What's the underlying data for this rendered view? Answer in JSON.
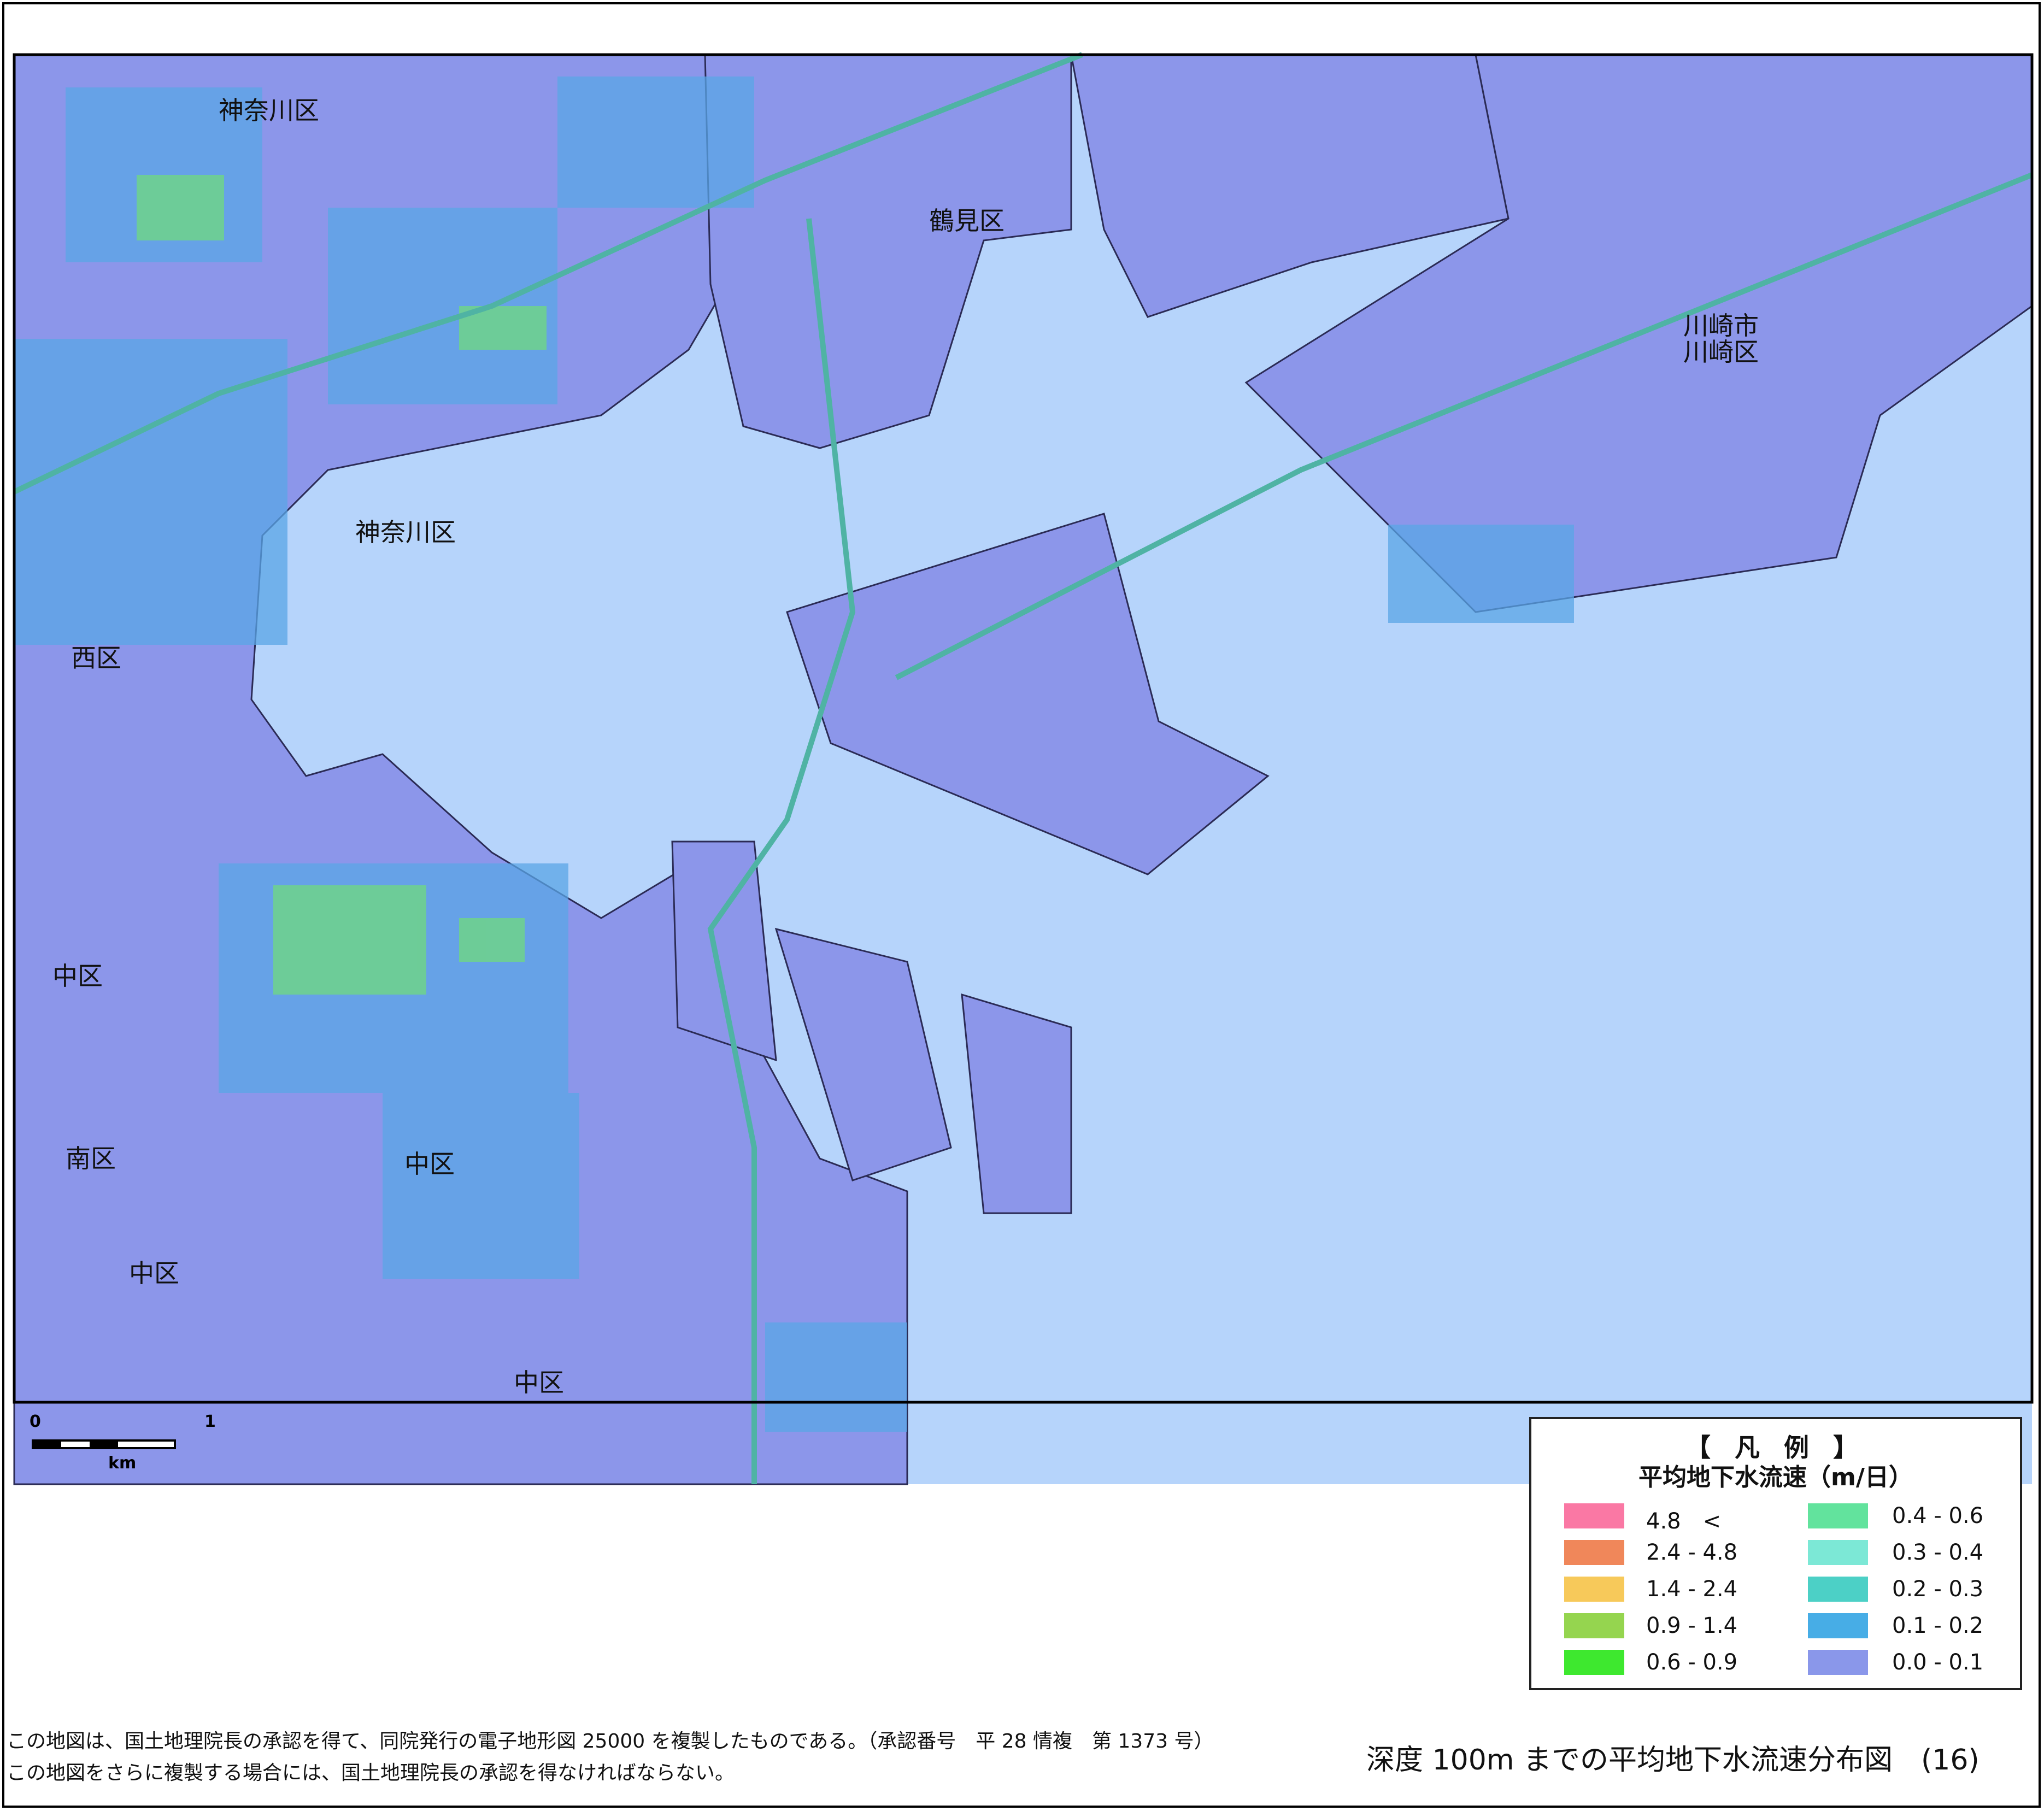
{
  "map": {
    "colors": {
      "land": "#8c96ea",
      "water": "#b6d4fb",
      "velocity_mid": "#5aa6e6",
      "velocity_high": "#6fd48a",
      "road_expressway": "#4fb3a4",
      "boundary": "#222222"
    },
    "labels": {
      "kanagawa_north": "神奈川区",
      "kanagawa_port": "神奈川区",
      "tsurumi": "鶴見区",
      "kawasaki_city": "川崎市",
      "kawasaki_ward": "川崎区",
      "nishi": "西区",
      "naka_1": "中区",
      "naka_2": "中区",
      "naka_3": "中区",
      "naka_4": "中区",
      "minami": "南区"
    },
    "scale": {
      "zero": "0",
      "one": "1",
      "unit": "km"
    }
  },
  "legend": {
    "title": "【 凡 例 】",
    "subtitle": "平均地下水流速（m/日）",
    "items": [
      {
        "label": "4.8　<",
        "color": "#fa78a4"
      },
      {
        "label": "2.4 - 4.8",
        "color": "#f0875a"
      },
      {
        "label": "1.4 - 2.4",
        "color": "#f7c95a"
      },
      {
        "label": "0.9 - 1.4",
        "color": "#95d54f"
      },
      {
        "label": "0.6 - 0.9",
        "color": "#3ee82f"
      },
      {
        "label": "0.4 - 0.6",
        "color": "#62e39d"
      },
      {
        "label": "0.3 - 0.4",
        "color": "#7ce8d6"
      },
      {
        "label": "0.2 - 0.3",
        "color": "#4cd0c6"
      },
      {
        "label": "0.1 - 0.2",
        "color": "#47ade6"
      },
      {
        "label": "0.0 - 0.1",
        "color": "#8a97ea"
      }
    ]
  },
  "notes": {
    "line1": "この地図は、国土地理院長の承認を得て、同院発行の電子地形図 25000 を複製したものである。（承認番号　平 28 情複　第 1373 号）",
    "line2": "この地図をさらに複製する場合には、国土地理院長の承認を得なければならない。"
  },
  "figure_title": "深度 100m までの平均地下水流速分布図　(16)"
}
